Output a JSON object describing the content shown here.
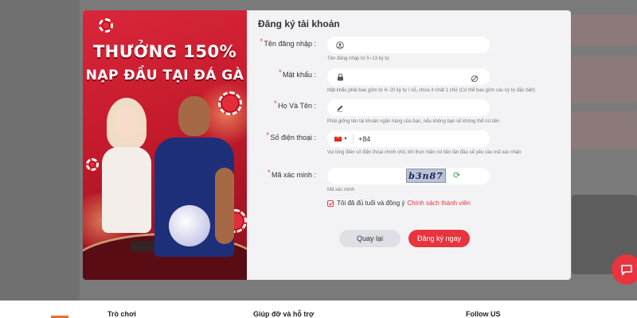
{
  "modal": {
    "banner": {
      "title_line1": "THƯỞNG 150%",
      "title_line2": "NẠP ĐẦU TẠI ĐÁ GÀ"
    },
    "form": {
      "title": "Đăng ký tài khoản",
      "fields": {
        "username": {
          "label": "Tên đăng nhập",
          "value": "",
          "icon": "user-icon",
          "hint": "Tên đăng nhập từ 5~13 ký tự"
        },
        "password": {
          "label": "Mật khẩu",
          "value": "",
          "icon": "lock-icon",
          "hint": "Mật khẩu phải bao gồm từ 6~20 ký tự / số, chứa ít nhất 1 chữ (Có thể bao gồm các ký tự đặc biệt)"
        },
        "fullname": {
          "label": "Họ Và Tên",
          "value": "",
          "icon": "edit-icon",
          "hint": "Phải giống tên tài khoản ngân hàng của bạn, nếu không bạn sẽ không thể rút tiền"
        },
        "phone": {
          "label": "Số điện thoại",
          "country_code": "+84",
          "value": "",
          "hint": "Vui lòng điền số điện thoại chính chủ, khi thực hiện rút tiền lần đầu sẽ yêu cầu mã xác nhận"
        },
        "captcha": {
          "label": "Mã xác minh",
          "value": "",
          "captcha_text": "b3n87",
          "hint": "Mã xác minh"
        }
      },
      "agree_text": "Tôi đã đủ tuổi và đồng ý",
      "agree_link": "Chính sách thành viên",
      "back_label": "Quay lại",
      "submit_label": "Đăng ký ngay"
    }
  },
  "footer": {
    "col1": "Trò chơi",
    "col2": "Giúp đỡ và hỗ trợ",
    "col3": "Follow US"
  },
  "colors": {
    "accent": "#e8343f",
    "banner": "#c41a2c",
    "modal_bg": "#f3f3f5"
  }
}
